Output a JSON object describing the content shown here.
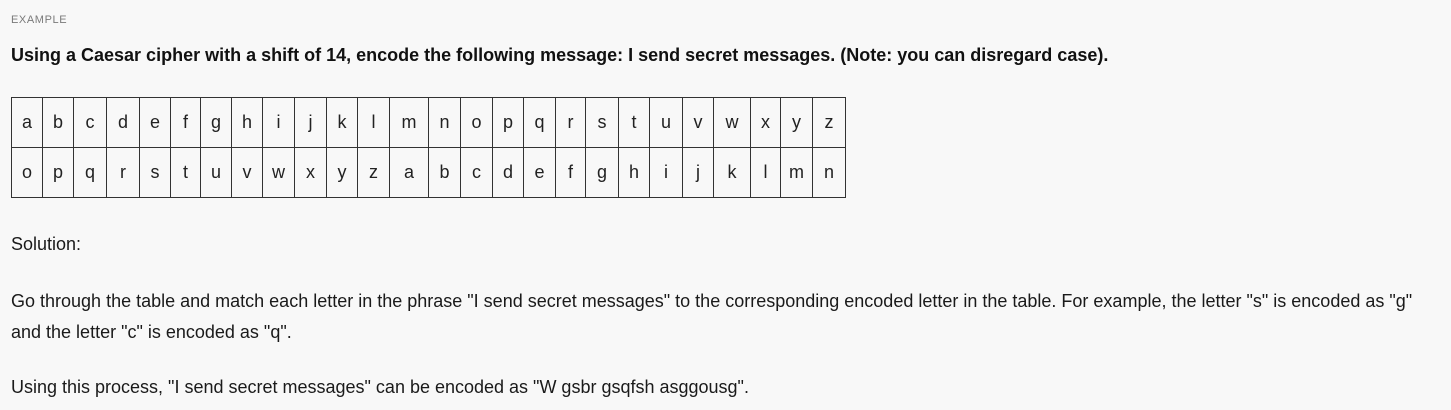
{
  "section_label": "EXAMPLE",
  "question": "Using a Caesar cipher with a shift of 14, encode the following message: I send secret messages. (Note: you can disregard case).",
  "cipher_table": {
    "plain": [
      "a",
      "b",
      "c",
      "d",
      "e",
      "f",
      "g",
      "h",
      "i",
      "j",
      "k",
      "l",
      "m",
      "n",
      "o",
      "p",
      "q",
      "r",
      "s",
      "t",
      "u",
      "v",
      "w",
      "x",
      "y",
      "z"
    ],
    "encoded": [
      "o",
      "p",
      "q",
      "r",
      "s",
      "t",
      "u",
      "v",
      "w",
      "x",
      "y",
      "z",
      "a",
      "b",
      "c",
      "d",
      "e",
      "f",
      "g",
      "h",
      "i",
      "j",
      "k",
      "l",
      "m",
      "n"
    ]
  },
  "solution_label": "Solution:",
  "paragraph_1": "Go through the table and match each letter in the phrase \"I send secret messages\" to the corresponding encoded letter in the table. For example, the letter \"s\" is encoded as \"g\" and the letter \"c\" is encoded as \"q\".",
  "paragraph_2": "Using this process, \"I send secret messages\" can be encoded as \"W gsbr gsqfsh asggousg\"."
}
